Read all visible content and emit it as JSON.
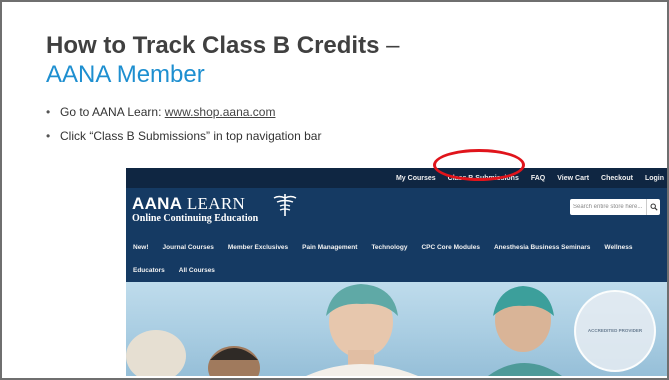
{
  "slide": {
    "title_bold": "How to Track Class B Credits",
    "title_dash": " –",
    "title_line2": "AANA Member",
    "bullets": [
      {
        "text": "Go to AANA Learn: ",
        "link": "www.shop.aana.com"
      },
      {
        "text": "Click “Class B Submissions” in top navigation bar"
      }
    ]
  },
  "site": {
    "top_nav": [
      "My Courses",
      "Class B Submissions",
      "FAQ",
      "View Cart",
      "Checkout",
      "Login"
    ],
    "logo_aana": "AANA",
    "logo_learn": "LEARN",
    "logo_sub": "Online Continuing Education",
    "search_placeholder": "Search entire store here...",
    "main_nav_row1": [
      "New!",
      "Journal Courses",
      "Member Exclusives",
      "Pain Management",
      "Technology",
      "CPC Core Modules",
      "Anesthesia Business Seminars",
      "Wellness"
    ],
    "main_nav_row2": [
      "Educators",
      "All Courses"
    ],
    "badge": "ACCREDITED PROVIDER"
  },
  "colors": {
    "accent_title": "#1e8fd0",
    "highlight": "#e0141b",
    "site_header": "#153a63"
  },
  "icons": [
    "search-icon",
    "caduceus-emblem-icon"
  ]
}
